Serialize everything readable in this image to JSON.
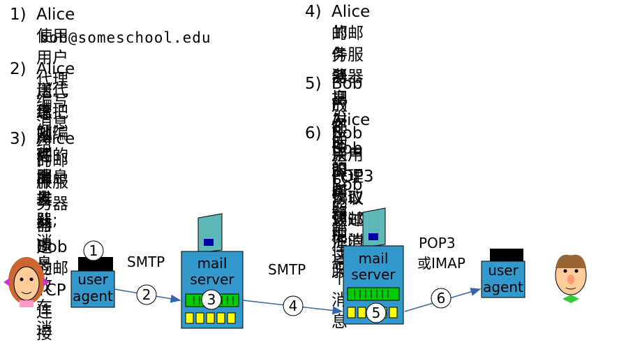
{
  "steps_left": [
    {
      "num": "1)",
      "lines": [
        "Alice使用用户代理编写消息给"
      ],
      "email": "bob@someschool.edu"
    },
    {
      "num": "2)",
      "lines": [
        "Alice用代理把她编写的消息发",
        "送给邮件服务器; 消息放在消",
        "息队列中排队"
      ]
    },
    {
      "num": "3)",
      "lines": [
        "Alice的邮件服务器与Bob的邮",
        "件服务器建立TCP连接"
      ]
    }
  ],
  "steps_right": [
    {
      "num": "4)",
      "lines": [
        "Alice的邮件服务器把Alice的",
        "邮件消息发送给Bob的邮件服",
        "务器"
      ]
    },
    {
      "num": "5)",
      "lines": [
        "Bob的邮件服务器把这个消息",
        "放在Bob的邮箱中"
      ]
    },
    {
      "num": "6)",
      "lines": [
        "Bob采用POP3协议通过他的",
        "用户代理读取该邮件消息。"
      ]
    }
  ],
  "diagram": {
    "left_agent": [
      "user",
      "agent"
    ],
    "left_server": [
      "mail",
      "server"
    ],
    "right_server": [
      "mail",
      "server"
    ],
    "right_agent": [
      "user",
      "agent"
    ],
    "smtp_1": "SMTP",
    "smtp_2": "SMTP",
    "pop_line1": "POP3",
    "pop_line2": "或IMAP",
    "markers": [
      "1",
      "2",
      "3",
      "4",
      "5",
      "6"
    ]
  },
  "colors": {
    "box": "#3399cc",
    "queue": "#00cc00",
    "mailbox": "#ffff00",
    "tower": "#5fb8b8"
  }
}
